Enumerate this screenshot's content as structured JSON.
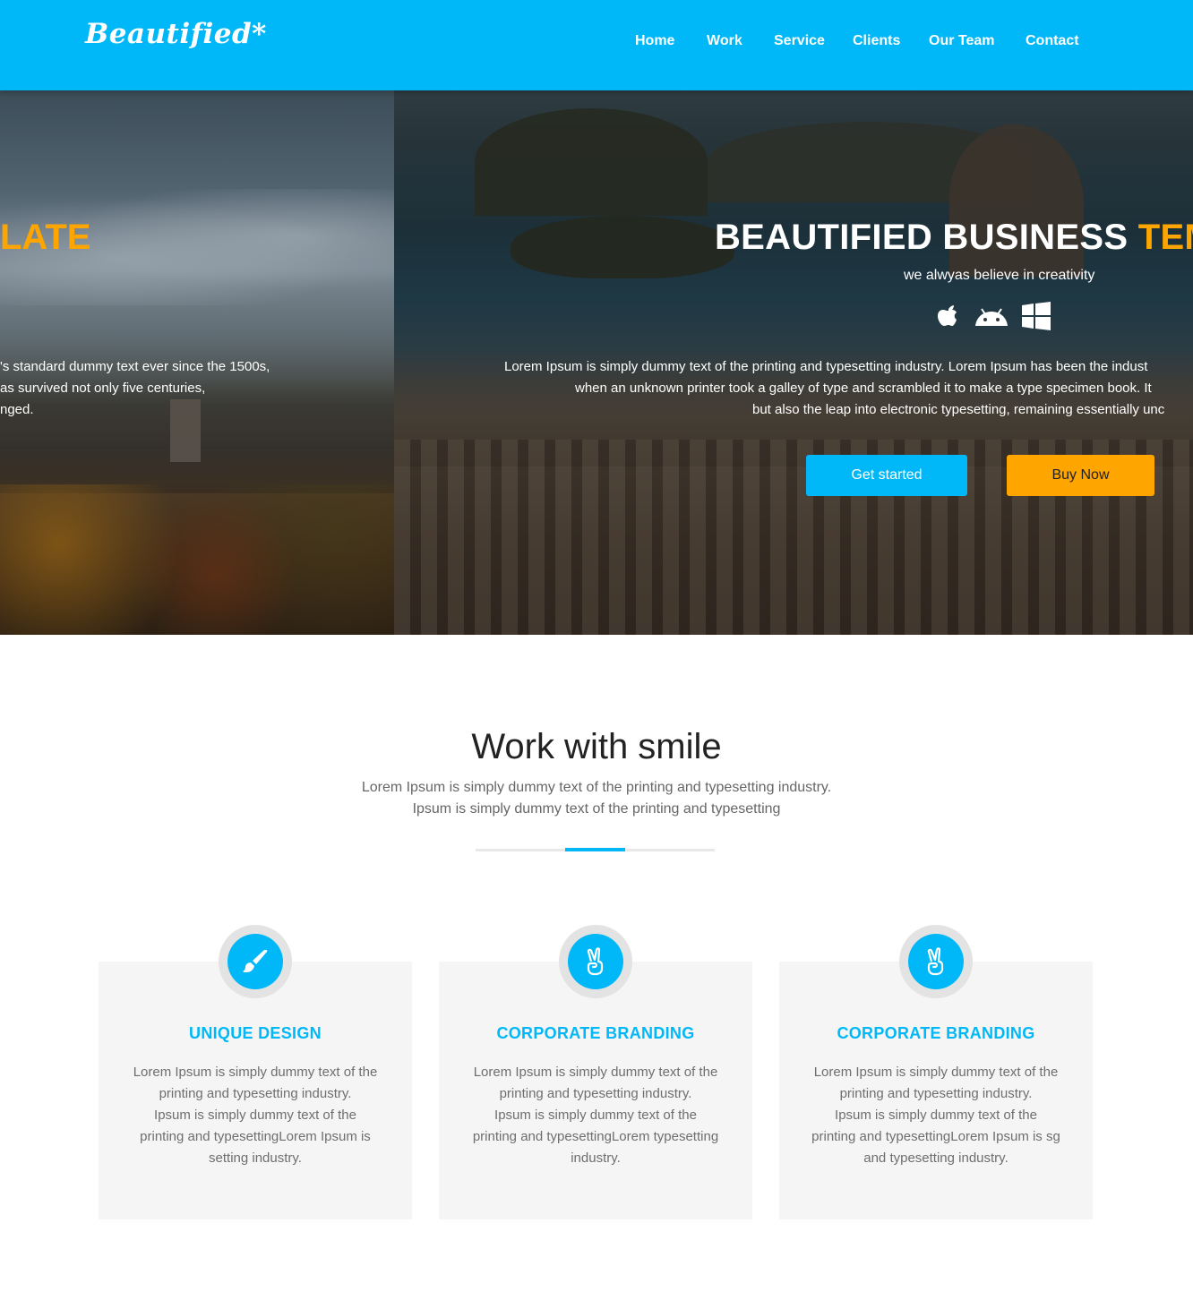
{
  "header": {
    "logo": "Beautified*",
    "nav": [
      {
        "label": "Home"
      },
      {
        "label": "Work"
      },
      {
        "label": "Service"
      },
      {
        "label": "Clients"
      },
      {
        "label": "Our Team"
      },
      {
        "label": "Contact"
      }
    ]
  },
  "hero": {
    "prev_slide": {
      "title_fragment": "LATE",
      "text_lines": [
        "'s standard dummy text ever since the 1500s,",
        "as survived not only five centuries,",
        "nged."
      ]
    },
    "title": "BEAUTIFIED BUSINESS ",
    "title_accent": "TEMP",
    "subtitle": "we alwyas believe in creativity",
    "platform_icons": [
      "apple-icon",
      "android-icon",
      "windows-icon"
    ],
    "text_lines": [
      "Lorem Ipsum is simply dummy text of the printing and typesetting industry. Lorem Ipsum has been the indust",
      "when an unknown printer took a galley of type and scrambled it to make a type specimen book. It",
      "but also the leap into electronic typesetting, remaining essentially unc"
    ],
    "primary_button": "Get started",
    "secondary_button": "Buy Now"
  },
  "features": {
    "title": "Work with smile",
    "subtitle_lines": [
      "Lorem Ipsum is simply dummy text of the printing and typesetting industry.",
      "Ipsum is simply dummy text of the printing and typesetting"
    ],
    "cards": [
      {
        "icon": "paintbrush-icon",
        "title": "UNIQUE DESIGN",
        "text_lines": [
          "Lorem Ipsum is simply dummy text of the",
          "printing and typesetting industry.",
          "Ipsum is simply dummy text of the",
          "printing and typesettingLorem Ipsum is",
          "setting industry."
        ]
      },
      {
        "icon": "peace-hand-icon",
        "title": "CORPORATE BRANDING",
        "text_lines": [
          "Lorem Ipsum is simply dummy text of the",
          "printing and typesetting industry.",
          "Ipsum is simply dummy text of the",
          "printing and typesettingLorem typesetting",
          "industry."
        ]
      },
      {
        "icon": "peace-hand-icon",
        "title": "CORPORATE BRANDING",
        "text_lines": [
          "Lorem Ipsum is simply dummy text of the",
          "printing and typesetting industry.",
          "Ipsum is simply dummy text of the",
          "printing and typesettingLorem Ipsum is sg",
          "and typesetting industry."
        ]
      }
    ]
  },
  "colors": {
    "brand": "#00b8f8",
    "accent": "#ffa500",
    "card_bg": "#f5f5f5"
  }
}
